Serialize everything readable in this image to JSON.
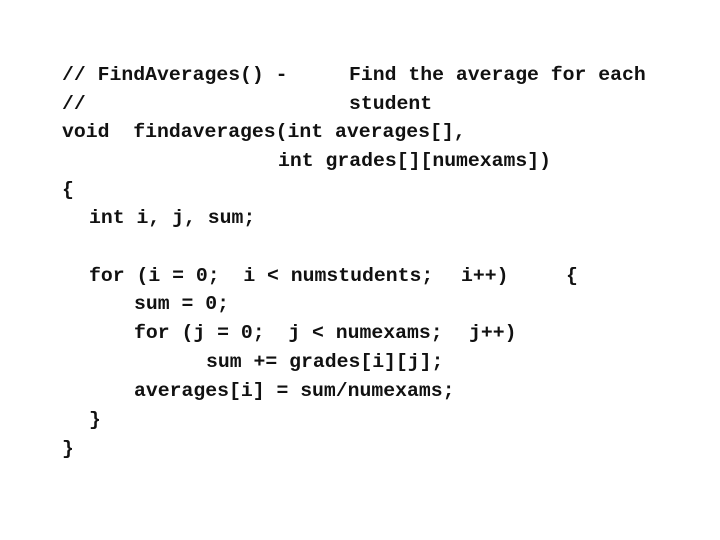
{
  "code": {
    "comment_line1_left": "// FindAverages() -",
    "comment_line1_right": "Find the average for each",
    "comment_line2_left": "//",
    "comment_line2_right": "student",
    "signature_line1": "void  findaverages(int averages[],",
    "signature_line2": "int grades[][numexams])",
    "open_brace": "{",
    "declaration": "int i, j, sum;",
    "outer_for_head": "for (i = 0;  i < numstudents;",
    "outer_for_incr": "i++)",
    "outer_for_brace": "{",
    "sum_reset": "sum = 0;",
    "inner_for_head": "for (j = 0;  j < numexams;",
    "inner_for_incr": "j++)",
    "accumulate": "sum += grades[i][j];",
    "average_assign": "averages[i] = sum/numexams;",
    "outer_close_brace": "}",
    "function_close_brace": "}"
  }
}
